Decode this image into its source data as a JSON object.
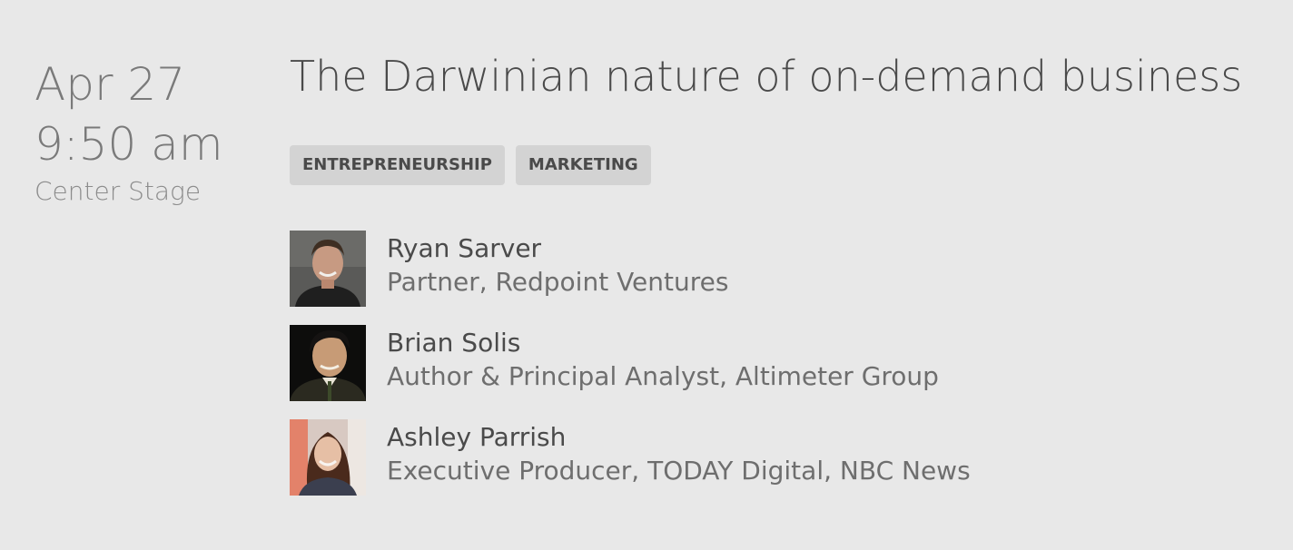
{
  "session": {
    "date": "Apr 27",
    "time": "9:50 am",
    "room": "Center Stage",
    "title": "The Darwinian nature of on-demand business",
    "tags": [
      {
        "label": "ENTREPRENEURSHIP"
      },
      {
        "label": "MARKETING"
      }
    ],
    "speakers": [
      {
        "name": "Ryan Sarver",
        "role": "Partner, Redpoint Ventures",
        "avatar_icon": "person-photo-icon"
      },
      {
        "name": "Brian Solis",
        "role": "Author & Principal Analyst, Altimeter Group",
        "avatar_icon": "person-photo-icon"
      },
      {
        "name": "Ashley Parrish",
        "role": "Executive Producer, TODAY Digital, NBC News",
        "avatar_icon": "person-photo-icon"
      }
    ]
  },
  "colors": {
    "background": "#e8e8e8",
    "tag_background": "#d3d3d3",
    "text_primary": "#4a4a4a",
    "text_muted": "#7a7a7a"
  }
}
